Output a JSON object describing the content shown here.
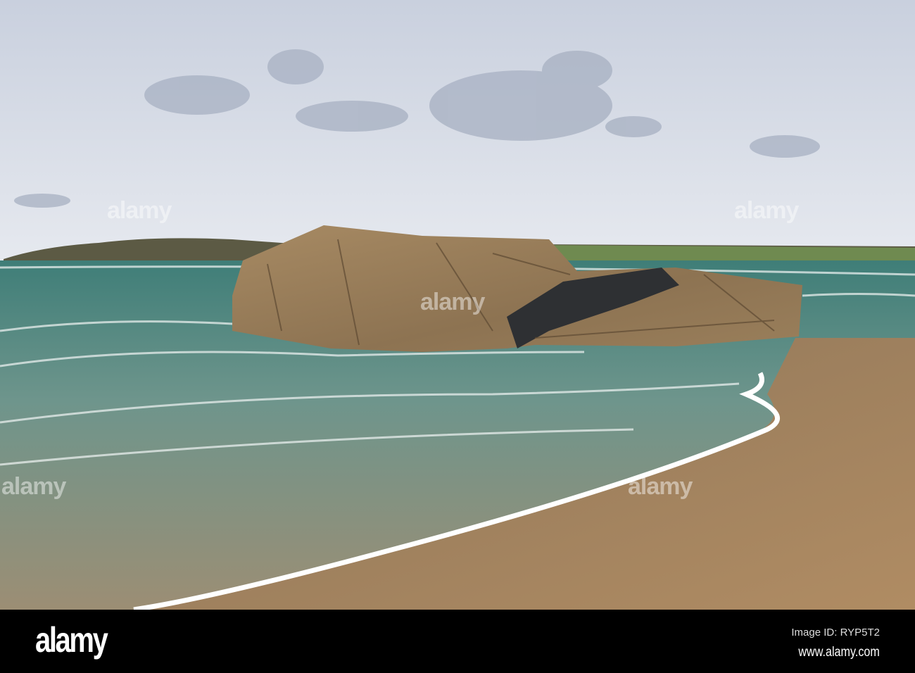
{
  "photo": {
    "subject": "rock",
    "colors": {
      "sky": "#d9dee8",
      "cloud": "#aeb7c8",
      "sea": "#4f8a82",
      "sand": "#a4825e",
      "rock": "#9a7c55",
      "foam": "#ffffff"
    }
  },
  "watermark": {
    "text": "alamy"
  },
  "footer": {
    "logo": "alamy",
    "image_id": "Image ID: RYP5T2",
    "url": "www.alamy.com"
  }
}
